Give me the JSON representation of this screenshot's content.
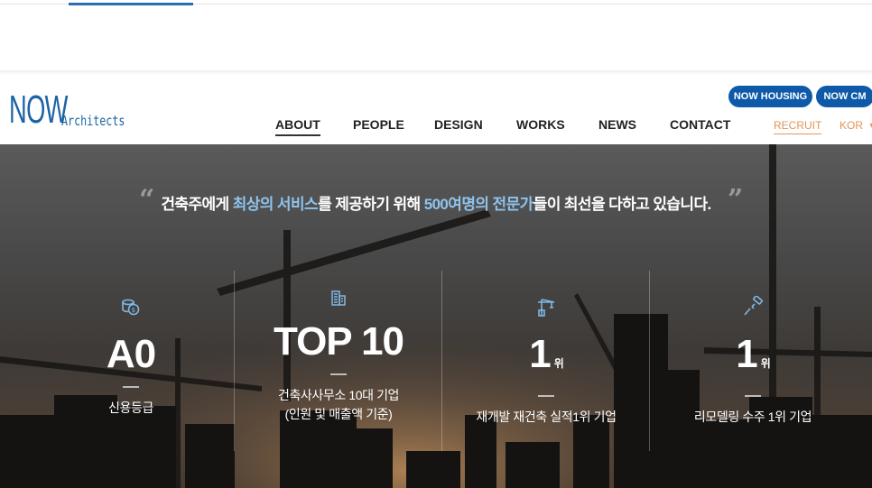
{
  "header": {
    "logo": {
      "main": "NOW",
      "sub": "Architects"
    },
    "buttons": [
      {
        "label": "NOW HOUSING"
      },
      {
        "label": "NOW CM"
      }
    ],
    "nav": [
      {
        "label": "ABOUT"
      },
      {
        "label": "PEOPLE"
      },
      {
        "label": "DESIGN"
      },
      {
        "label": "WORKS"
      },
      {
        "label": "NEWS"
      },
      {
        "label": "CONTACT"
      }
    ],
    "recruit": "RECRUIT",
    "lang": "KOR"
  },
  "hero": {
    "quote": {
      "part1": "건축주에게 ",
      "highlight1": "최상의 서비스",
      "part2": "를 제공하기 위해 ",
      "highlight2": "500여명의 전문가",
      "part3": "들이 최선을 다하고 있습니다."
    },
    "stats": [
      {
        "icon": "coins-icon",
        "value": "A0",
        "suffix": "",
        "label1": "신용등급",
        "label2": ""
      },
      {
        "icon": "building-icon",
        "value": "TOP 10",
        "suffix": "",
        "label1": "건축사사무소 10대 기업",
        "label2": "(인원 및 매출액 기준)"
      },
      {
        "icon": "crane-icon",
        "value": "1",
        "suffix": "위",
        "label1": "재개발 재건축 실적1위 기업",
        "label2": ""
      },
      {
        "icon": "paint-roller-icon",
        "value": "1",
        "suffix": "위",
        "label1": "리모델링 수주 1위 기업",
        "label2": ""
      }
    ]
  },
  "colors": {
    "brand_blue": "#1d63a6",
    "pill_blue": "#0f5aa8",
    "highlight": "#8fc3ec",
    "recruit_orange": "#e0965a",
    "icon_blue": "#7fb8e6"
  }
}
